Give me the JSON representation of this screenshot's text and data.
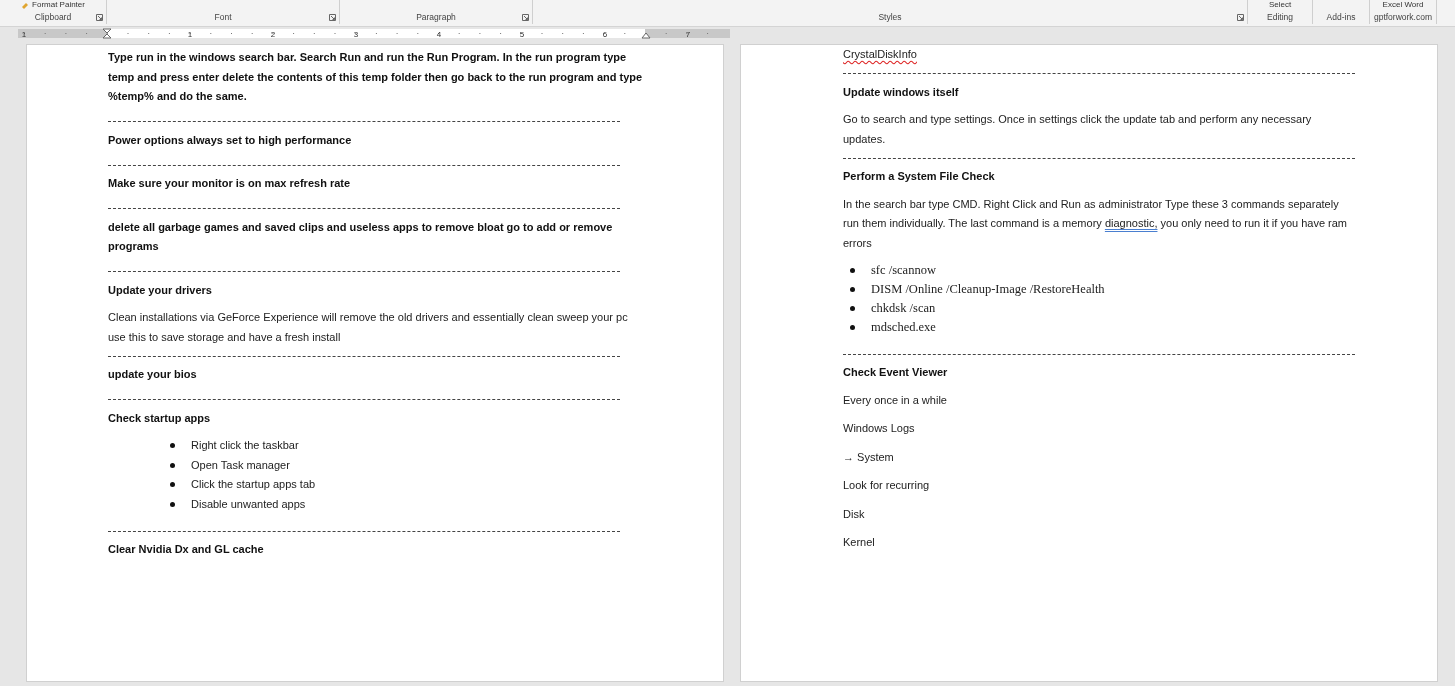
{
  "ribbon": {
    "groups": [
      {
        "label": "Clipboard",
        "button": "Format Painter",
        "launcher": true
      },
      {
        "label": "Font",
        "launcher": true
      },
      {
        "label": "Paragraph",
        "launcher": true
      },
      {
        "label": "Styles",
        "launcher": true
      },
      {
        "label": "Editing",
        "button": "Select",
        "launcher": false
      },
      {
        "label": "Add-ins",
        "launcher": false
      },
      {
        "label": "gptforwork.com",
        "button": "Excel Word",
        "launcher": false
      }
    ]
  },
  "ruler": {
    "numbers": [
      "1",
      "1",
      "2",
      "3",
      "4",
      "5",
      "6",
      "7"
    ]
  },
  "pages": [
    {
      "blocks": [
        {
          "kind": "heading",
          "text": "Type run in the windows search bar. Search Run and run the Run Program. In the run program type temp and press enter delete the contents of this temp folder then go back to the run program and type %temp% and do the same."
        },
        {
          "kind": "divider"
        },
        {
          "kind": "heading",
          "text": "Power options always set to high performance"
        },
        {
          "kind": "divider"
        },
        {
          "kind": "heading",
          "text": "Make sure your monitor is on max refresh rate"
        },
        {
          "kind": "divider"
        },
        {
          "kind": "heading",
          "text": "delete all garbage games and saved clips and useless apps to remove bloat go to add or remove programs"
        },
        {
          "kind": "divider"
        },
        {
          "kind": "heading",
          "text": "Update your drivers"
        },
        {
          "kind": "para",
          "runs": [
            {
              "text": "Clean installations via GeForce Experience will remove the old drivers and essentially clean sweep your pc use this to save storage and have a fresh install"
            }
          ]
        },
        {
          "kind": "divider"
        },
        {
          "kind": "heading",
          "text": "update your bios"
        },
        {
          "kind": "divider"
        },
        {
          "kind": "heading",
          "text": "Check startup apps"
        },
        {
          "kind": "bullet_list",
          "items": [
            "Right click the taskbar",
            "Open Task manager",
            "Click the startup apps tab",
            "Disable unwanted apps"
          ]
        },
        {
          "kind": "divider"
        },
        {
          "kind": "heading",
          "text": "Clear Nvidia Dx and GL cache"
        }
      ]
    },
    {
      "blocks": [
        {
          "kind": "para",
          "runs": [
            {
              "text": "CrystalDiskInfo",
              "spelling_error": true
            }
          ]
        },
        {
          "kind": "divider"
        },
        {
          "kind": "heading",
          "text": "Update windows itself"
        },
        {
          "kind": "para",
          "runs": [
            {
              "text": "Go to search and type settings. Once in settings click the update tab and perform any necessary updates."
            }
          ]
        },
        {
          "kind": "divider"
        },
        {
          "kind": "heading",
          "text": "Perform a System File Check"
        },
        {
          "kind": "para",
          "runs": [
            {
              "text": "In the search bar type CMD. Right Click and Run as administrator Type these 3 commands separately run them individually. The last command is a memory "
            },
            {
              "text": "diagnostic,",
              "grammar_error": true
            },
            {
              "text": " you only need to run it if you have ram errors"
            }
          ]
        },
        {
          "kind": "command_list",
          "items": [
            "sfc /scannow",
            "DISM /Online /Cleanup-Image /RestoreHealth",
            "chkdsk /scan",
            "mdsched.exe"
          ]
        },
        {
          "kind": "divider"
        },
        {
          "kind": "heading",
          "text": "Check Event Viewer"
        },
        {
          "kind": "para",
          "runs": [
            {
              "text": "Every once in a while"
            }
          ]
        },
        {
          "kind": "para",
          "runs": [
            {
              "text": "Windows Logs"
            }
          ]
        },
        {
          "kind": "para",
          "runs": [
            {
              "text": "→ System"
            }
          ]
        },
        {
          "kind": "para",
          "runs": [
            {
              "text": "Look for recurring"
            }
          ]
        },
        {
          "kind": "para",
          "runs": [
            {
              "text": "Disk"
            }
          ]
        },
        {
          "kind": "para",
          "runs": [
            {
              "text": "Kernel"
            }
          ]
        }
      ]
    }
  ]
}
